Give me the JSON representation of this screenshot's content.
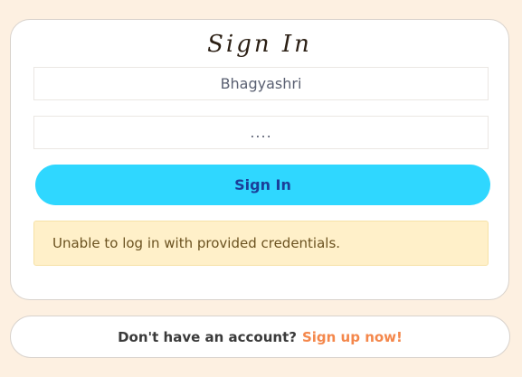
{
  "login": {
    "title": "Sign In",
    "username_value": "Bhagyashri",
    "password_value": "....",
    "submit_label": "Sign In",
    "error_message": "Unable to log in with provided credentials."
  },
  "signup": {
    "prompt": "Don't have an account?",
    "link_label": "Sign up now!"
  },
  "colors": {
    "background": "#fdf0e1",
    "button": "#2fd7ff",
    "button_text": "#1b3f99",
    "alert_bg": "#fff0c9",
    "link": "#f4874b"
  }
}
